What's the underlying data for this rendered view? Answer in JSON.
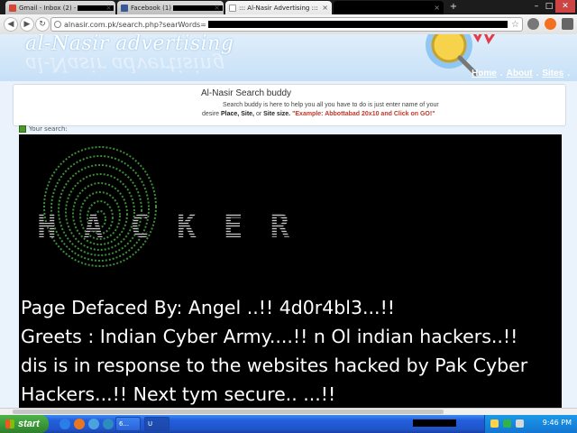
{
  "browser": {
    "tabs": [
      {
        "label": "Gmail - Inbox (2) -",
        "icon": "gmail-icon",
        "color": "#d44638"
      },
      {
        "label": "Facebook (1)",
        "icon": "facebook-icon",
        "color": "#3b5998"
      },
      {
        "label": "::: Al-Nasir Advertising :::",
        "icon": "page-icon",
        "color": "#ffffff"
      }
    ],
    "url": "alnasir.com.pk/search.php?searWords=",
    "new_tab": "+"
  },
  "site": {
    "logo": "al-Nasir advertising",
    "nav_links": [
      "Home",
      "About",
      "Sites"
    ],
    "nav_separator": ".",
    "search_buddy": {
      "title": "Al-Nasir Search buddy",
      "line1": "Search buddy is here to help you all you have to do is just enter name of your",
      "line2_prefix": "desire ",
      "place": "Place,",
      "site": "Site,",
      "or": " or ",
      "size": "Site size.",
      "example": "\"Example: Abbottabad 20x10 and Click on GO!\""
    },
    "your_search_label": "Your search:"
  },
  "deface": {
    "hacker_word": "HACKER",
    "line1": "Page Defaced By: Angel ..!! 4d0r4bl3...!!",
    "line2": "Greets : Indian Cyber Army....!!  n Ol indian hackers..!!",
    "line3": "dis is in response to the websites hacked by Pak Cyber",
    "line4": "Hackers...!! Next tym secure.. ...!!"
  },
  "taskbar": {
    "start_label": "start",
    "tasks": [
      {
        "label": "6..."
      },
      {
        "label": "U"
      }
    ],
    "clock": "9:46 PM"
  },
  "colors": {
    "print_green": "#3d8c3a",
    "taskbar_blue": "#245edb",
    "start_green": "#3c9b38"
  }
}
